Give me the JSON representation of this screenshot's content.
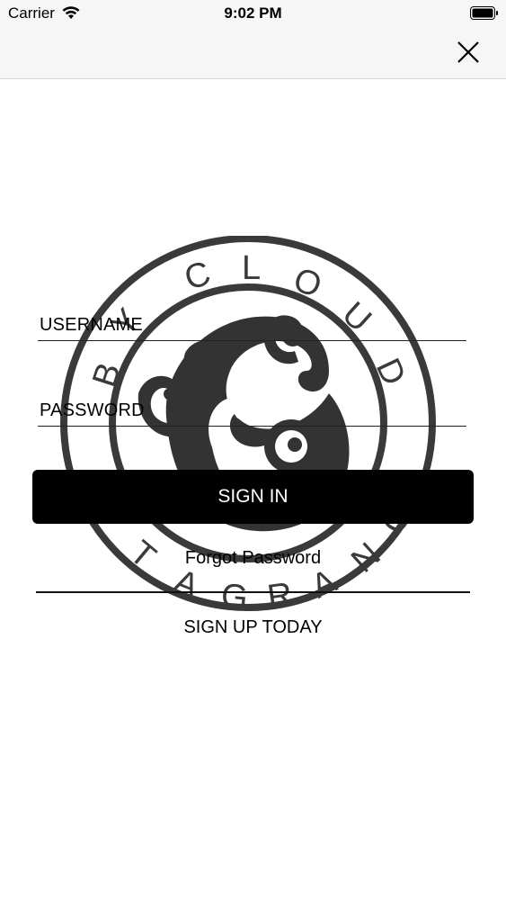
{
  "status_bar": {
    "carrier": "Carrier",
    "time": "9:02 PM"
  },
  "nav": {
    "close_icon": "close-icon"
  },
  "logo": {
    "text": "BY CLOUD  TAGRANO"
  },
  "form": {
    "username_label": "USERNAME",
    "password_label": "PASSWORD",
    "signin_label": "SIGN IN",
    "forgot_label": "Forgot Password",
    "signup_label": "SIGN UP TODAY"
  },
  "colors": {
    "primary_button": "#000000",
    "background": "#ffffff",
    "bar_background": "#f6f6f7"
  }
}
